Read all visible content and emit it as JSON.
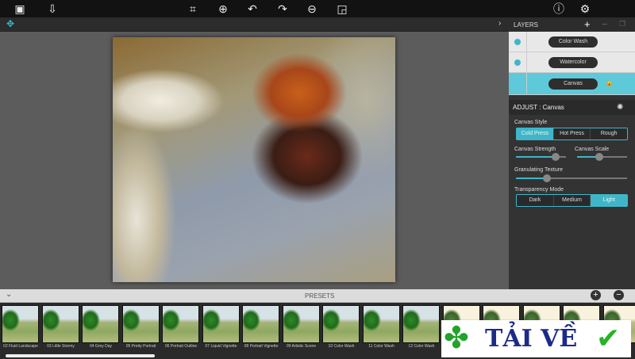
{
  "toolbar": {
    "icons": [
      "open-image-icon",
      "save-icon",
      "crop-icon",
      "zoom-in-icon",
      "undo-icon",
      "redo-icon",
      "zoom-out-icon",
      "fit-icon",
      "info-icon",
      "settings-icon"
    ]
  },
  "layers": {
    "title": "LAYERS",
    "add": "+",
    "remove": "−",
    "items": [
      {
        "name": "Color Wash"
      },
      {
        "name": "Watercolor"
      },
      {
        "name": "Canvas",
        "selected": true,
        "locked": true
      }
    ]
  },
  "adjust": {
    "title": "ADJUST : Canvas",
    "canvas_style": {
      "label": "Canvas Style",
      "options": [
        "Cold Press",
        "Hot Press",
        "Rough"
      ],
      "selected": "Cold Press"
    },
    "canvas_strength": {
      "label": "Canvas Strength",
      "value": 0.8
    },
    "canvas_scale": {
      "label": "Canvas Scale",
      "value": 0.45
    },
    "granulating_texture": {
      "label": "Granulating Texture",
      "value": 0.28
    },
    "transparency_mode": {
      "label": "Transparency Mode",
      "options": [
        "Dark",
        "Medium",
        "Light"
      ],
      "selected": "Light"
    }
  },
  "presets": {
    "title": "PRESETS",
    "items": [
      "02 Fluid Landscape",
      "03 Little Stormy",
      "04 Grey Day",
      "05 Pretty Portrait",
      "06 Portrait Outline",
      "07 Liquid Vignette",
      "08 Portrait Vignette",
      "09 Artistic Scene",
      "10 Color Wash",
      "11 Color Wash",
      "12 Color Wash"
    ]
  },
  "watermark": {
    "text": "TẢI VỀ"
  },
  "colors": {
    "accent": "#3fb6c8"
  }
}
